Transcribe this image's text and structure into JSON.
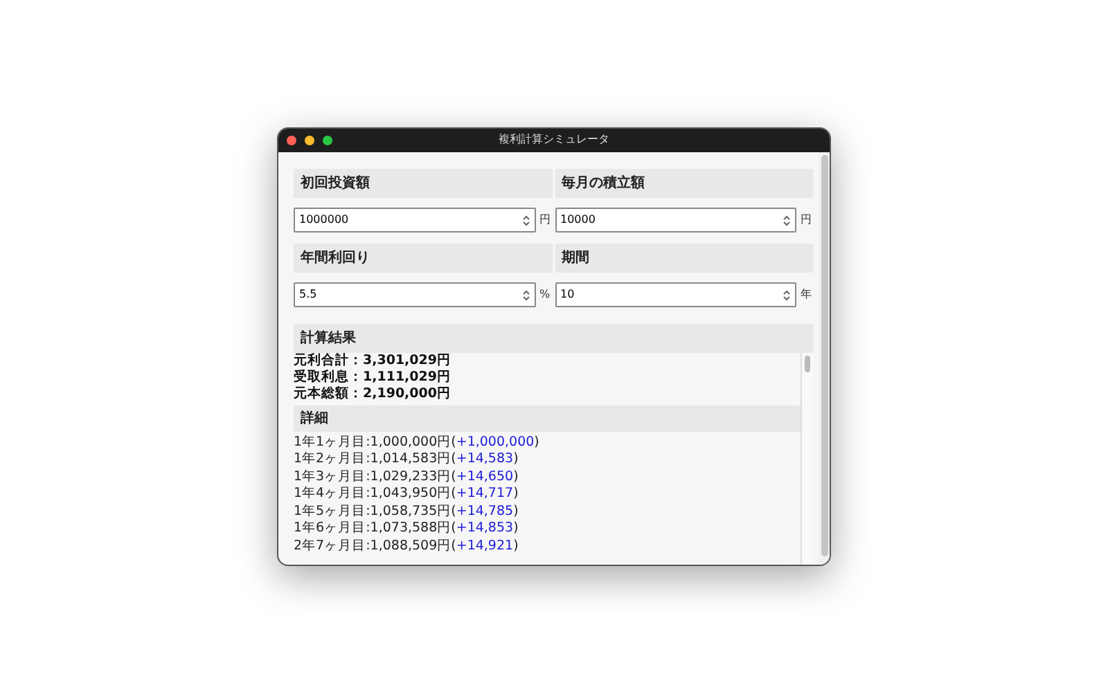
{
  "window": {
    "title": "複利計算シミュレータ"
  },
  "inputs": [
    {
      "label": "初回投資額",
      "value": "1000000",
      "unit": "円"
    },
    {
      "label": "毎月の積立額",
      "value": "10000",
      "unit": "円"
    },
    {
      "label": "年間利回り",
      "value": "5.5",
      "unit": "%"
    },
    {
      "label": "期間",
      "value": "10",
      "unit": "年"
    }
  ],
  "results": {
    "heading": "計算結果",
    "summary": [
      "元利合計：3,301,029円",
      "受取利息：1,111,029円",
      "元本総額：2,190,000円"
    ],
    "details_heading": "詳細",
    "details": [
      {
        "label": "1年1ヶ月目:1,000,000円(",
        "delta": "+1,000,000",
        "close": ")"
      },
      {
        "label": "1年2ヶ月目:1,014,583円(",
        "delta": "+14,583",
        "close": ")"
      },
      {
        "label": "1年3ヶ月目:1,029,233円(",
        "delta": "+14,650",
        "close": ")"
      },
      {
        "label": "1年4ヶ月目:1,043,950円(",
        "delta": "+14,717",
        "close": ")"
      },
      {
        "label": "1年5ヶ月目:1,058,735円(",
        "delta": "+14,785",
        "close": ")"
      },
      {
        "label": "1年6ヶ月目:1,073,588円(",
        "delta": "+14,853",
        "close": ")"
      },
      {
        "label": "2年7ヶ月目:1,088,509円(",
        "delta": "+14,921",
        "close": ")"
      }
    ]
  }
}
